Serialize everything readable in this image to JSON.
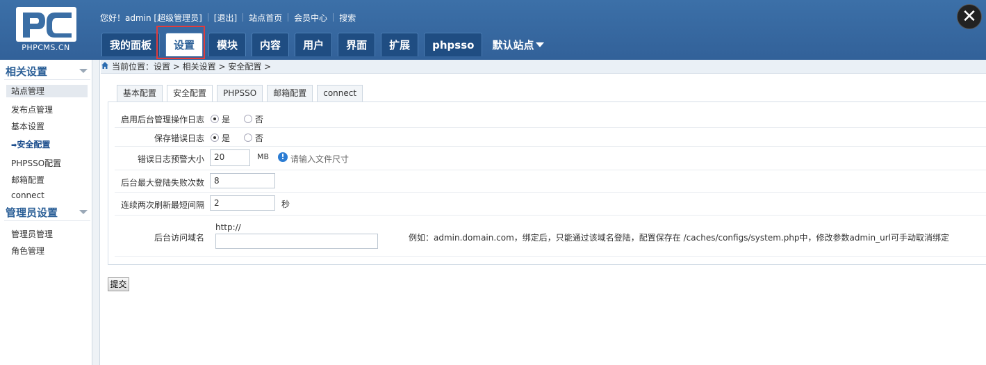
{
  "header": {
    "logo_text": "PHPCMS.CN",
    "greeting": "您好！admin [超级管理员]",
    "logout": "[退出]",
    "links": [
      "站点首页",
      "会员中心",
      "搜索"
    ],
    "close_glyph": "✕",
    "tabs": [
      {
        "label": "我的面板",
        "active": false
      },
      {
        "label": "设置",
        "active": true
      },
      {
        "label": "模块",
        "active": false
      },
      {
        "label": "内容",
        "active": false
      },
      {
        "label": "用户",
        "active": false
      },
      {
        "label": "界面",
        "active": false
      },
      {
        "label": "扩展",
        "active": false
      },
      {
        "label": "phpsso",
        "active": false
      }
    ],
    "site_switch": "默认站点"
  },
  "sidebar": {
    "group1": "相关设置",
    "items": [
      "站点管理",
      "发布点管理",
      "基本设置",
      "安全配置",
      "PHPSSO配置",
      "邮箱配置",
      "connect"
    ],
    "active_prefix": "➡",
    "group2": "管理员设置",
    "items2": [
      "管理员管理",
      "角色管理"
    ]
  },
  "breadcrumb": "当前位置：设置 > 相关设置 > 安全配置 >",
  "subtabs": [
    "基本配置",
    "安全配置",
    "PHPSSO",
    "邮箱配置",
    "connect"
  ],
  "form": {
    "admin_log": {
      "label": "启用后台管理操作日志",
      "yes": "是",
      "no": "否"
    },
    "err_log": {
      "label": "保存错误日志",
      "yes": "是",
      "no": "否"
    },
    "err_size": {
      "label": "错误日志预警大小",
      "value": "20",
      "unit": "MB",
      "hint": "请输入文件尺寸",
      "info_glyph": "!"
    },
    "max_fail": {
      "label": "后台最大登陆失败次数",
      "value": "8"
    },
    "refresh": {
      "label": "连续两次刷新最短间隔",
      "value": "2",
      "unit": "秒"
    },
    "domain": {
      "label": "后台访问域名",
      "prefix": "http://",
      "value": "",
      "note": "例如：admin.domain.com，绑定后，只能通过该域名登陆，配置保存在 /caches/configs/system.php中，修改参数admin_url可手动取消绑定"
    }
  },
  "submit_label": "提交",
  "colors": {
    "header": "#3a6ea5",
    "highlight": "#e23b3b",
    "link": "#2b5f97"
  }
}
